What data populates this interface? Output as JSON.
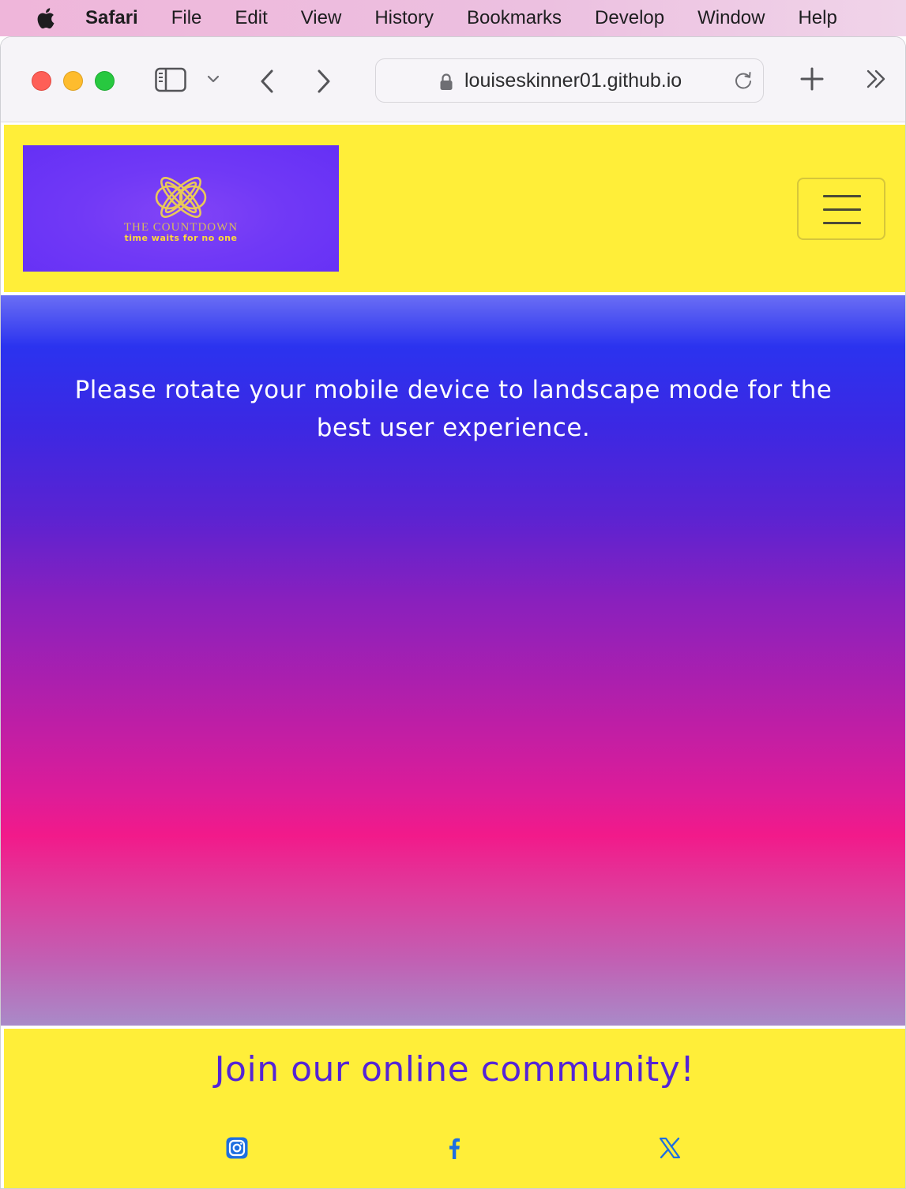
{
  "menubar": {
    "app": "Safari",
    "items": [
      "File",
      "Edit",
      "View",
      "History",
      "Bookmarks",
      "Develop",
      "Window",
      "Help"
    ]
  },
  "browser": {
    "url": "louiseskinner01.github.io"
  },
  "site": {
    "logo": {
      "name": "THE COUNTDOWN",
      "tagline": "time waits for no one"
    },
    "hero_message": "Please rotate your mobile device to landscape mode for the best user experience.",
    "footer_title": "Join our online community!",
    "social": [
      "instagram-icon",
      "facebook-icon",
      "x-icon"
    ]
  },
  "colors": {
    "header_bg": "#ffee39",
    "logo_bg": "#6530f5",
    "footer_title": "#5424d6",
    "social_icon": "#1e6fe0"
  }
}
